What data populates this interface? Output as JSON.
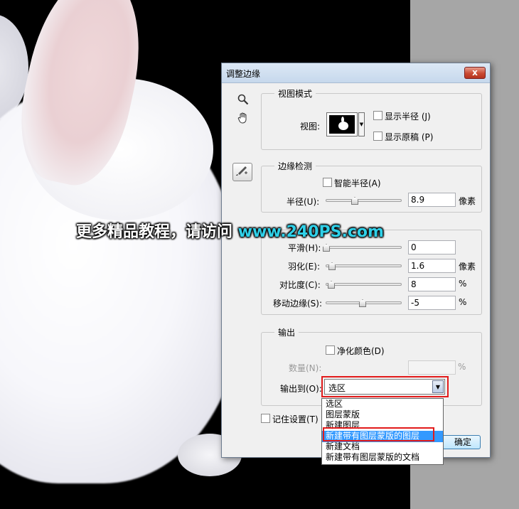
{
  "watermark": {
    "text": "更多精品教程，请访问 ",
    "url": "www.240PS.com"
  },
  "dialog": {
    "title": "调整边缘",
    "close_glyph": "x",
    "view_mode": {
      "legend": "视图模式",
      "view_label": "视图:",
      "show_radius": "显示半径 (J)",
      "show_original": "显示原稿 (P)"
    },
    "edge_detection": {
      "legend": "边缘检测",
      "smart_radius": "智能半径(A)",
      "radius_label": "半径(U):",
      "radius_value": "8.9",
      "radius_unit": "像素",
      "radius_level": 0.3
    },
    "adjust_edge": {
      "smooth_label": "平滑(H):",
      "smooth_value": "0",
      "feather_label": "羽化(E):",
      "feather_value": "1.6",
      "feather_unit": "像素",
      "contrast_label": "对比度(C):",
      "contrast_value": "8",
      "contrast_unit": "%",
      "shift_label": "移动边缘(S):",
      "shift_value": "-5",
      "shift_unit": "%"
    },
    "output": {
      "legend": "输出",
      "decontaminate": "净化颜色(D)",
      "amount_label": "数量(N):",
      "amount_unit": "%",
      "output_to_label": "输出到(O):",
      "output_to_value": "选区",
      "options": [
        "选区",
        "图层蒙版",
        "新建图层",
        "新建带有图层蒙版的图层",
        "新建文档",
        "新建带有图层蒙版的文档"
      ],
      "selected_index": 3
    },
    "remember_settings": "记住设置(T)",
    "ok_label": "确定"
  }
}
